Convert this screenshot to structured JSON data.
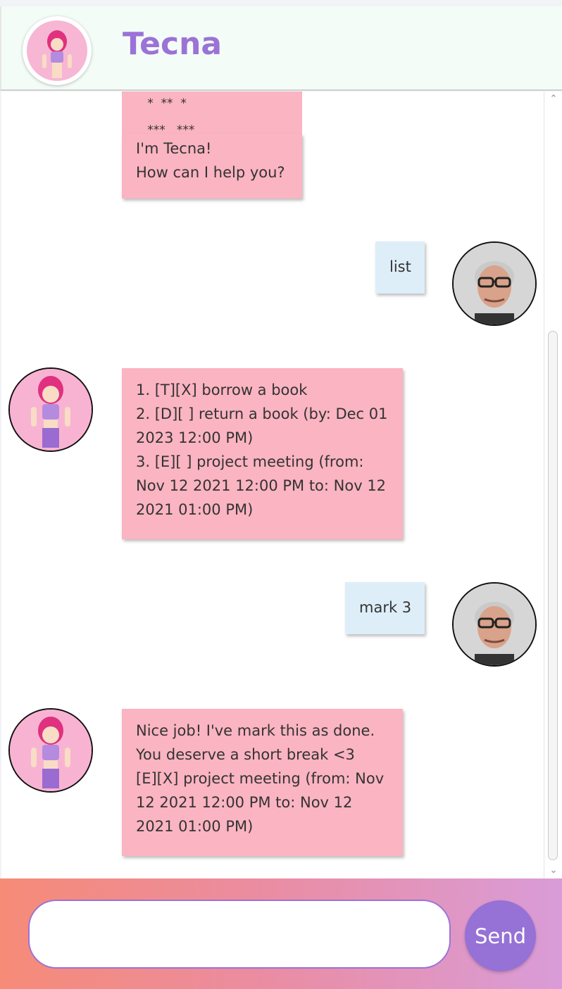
{
  "header": {
    "title": "Tecna",
    "bot_avatar_icon": "fairy-avatar-icon"
  },
  "messages": [
    {
      "sender": "bot",
      "lines": [
        "   *  **  *",
        "   ***   ***"
      ],
      "art": true
    },
    {
      "sender": "bot",
      "lines": [
        "I'm Tecna!",
        "How can I help you?"
      ]
    },
    {
      "sender": "user",
      "lines": [
        "list"
      ]
    },
    {
      "sender": "bot",
      "lines": [
        "1. [T][X] borrow a book",
        "2. [D][ ] return a book (by: Dec 01",
        "2023 12:00 PM)",
        "3. [E][ ] project meeting (from:",
        "Nov 12 2021 12:00 PM to: Nov 12",
        "2021 01:00 PM)"
      ]
    },
    {
      "sender": "user",
      "lines": [
        "mark 3"
      ]
    },
    {
      "sender": "bot",
      "lines": [
        "Nice job! I've mark this as done.",
        "You deserve a short break <3",
        "[E][X] project meeting (from: Nov",
        "12 2021 12:00 PM to: Nov 12",
        "2021 01:00 PM)"
      ]
    }
  ],
  "input": {
    "placeholder": "",
    "value": ""
  },
  "send_label": "Send",
  "colors": {
    "bot_bubble": "#fbb4c1",
    "user_bubble": "#deeef9",
    "accent": "#9671d6",
    "header_bg": "#f3fcf7"
  },
  "icons": {
    "bot_avatar": "fairy-avatar-icon",
    "user_avatar": "user-photo-avatar-icon"
  }
}
